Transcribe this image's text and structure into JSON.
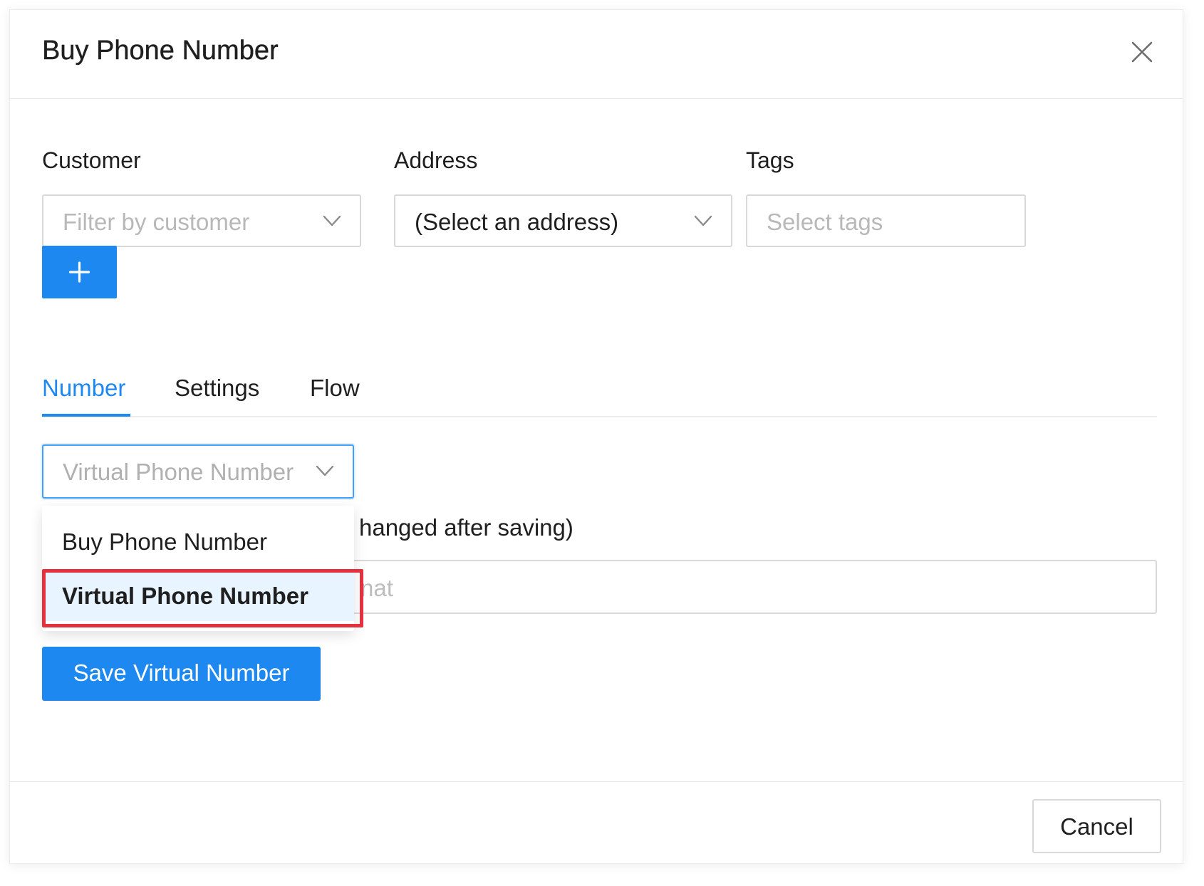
{
  "dialog": {
    "title": "Buy Phone Number"
  },
  "form": {
    "customer": {
      "label": "Customer",
      "placeholder": "Filter by customer"
    },
    "address": {
      "label": "Address",
      "value": "(Select an address)"
    },
    "tags": {
      "label": "Tags",
      "placeholder": "Select tags"
    },
    "add_button_label": "+"
  },
  "tabs": [
    {
      "label": "Number",
      "active": true
    },
    {
      "label": "Settings",
      "active": false
    },
    {
      "label": "Flow",
      "active": false
    }
  ],
  "number_tab": {
    "type_select_value": "Virtual Phone Number",
    "number_label_visible": "hanged after saving)",
    "number_placeholder_visible": "nat",
    "save_button_label": "Save Virtual Number"
  },
  "dropdown": {
    "options": [
      {
        "label": "Buy Phone Number",
        "selected": false
      },
      {
        "label": "Virtual Phone Number",
        "selected": true
      }
    ]
  },
  "footer": {
    "cancel_label": "Cancel"
  },
  "colors": {
    "accent": "#1d89f0",
    "highlight": "#e5313d",
    "selected_bg": "#e8f4ff"
  }
}
